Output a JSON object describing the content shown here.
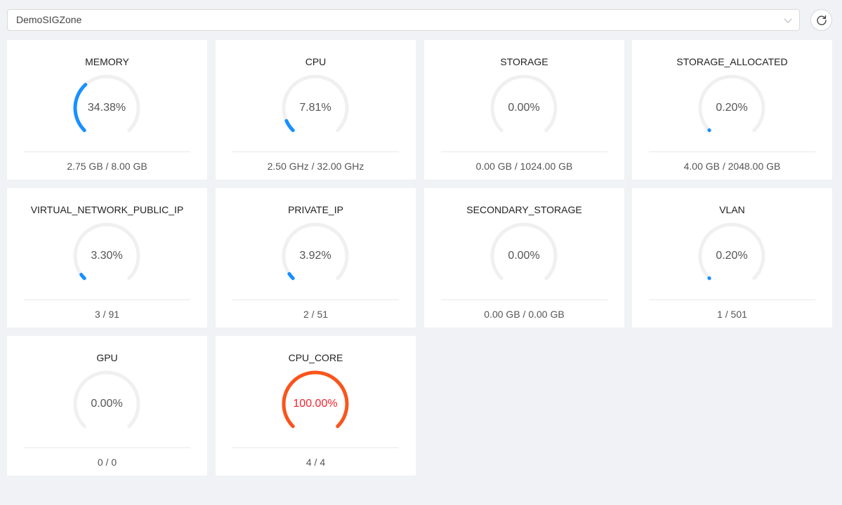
{
  "zone_selector": {
    "value": "DemoSIGZone"
  },
  "colors": {
    "normal": "#1890ff",
    "full": "#fa541c",
    "track": "#f0f0f0"
  },
  "cards": [
    {
      "title": "MEMORY",
      "percent_label": "34.38%",
      "percent": 34.38,
      "usage": "2.75 GB / 8.00 GB"
    },
    {
      "title": "CPU",
      "percent_label": "7.81%",
      "percent": 7.81,
      "usage": "2.50 GHz / 32.00 GHz"
    },
    {
      "title": "STORAGE",
      "percent_label": "0.00%",
      "percent": 0,
      "usage": "0.00 GB / 1024.00 GB"
    },
    {
      "title": "STORAGE_ALLOCATED",
      "percent_label": "0.20%",
      "percent": 0.2,
      "usage": "4.00 GB / 2048.00 GB"
    },
    {
      "title": "VIRTUAL_NETWORK_PUBLIC_IP",
      "percent_label": "3.30%",
      "percent": 3.3,
      "usage": "3 / 91"
    },
    {
      "title": "PRIVATE_IP",
      "percent_label": "3.92%",
      "percent": 3.92,
      "usage": "2 / 51"
    },
    {
      "title": "SECONDARY_STORAGE",
      "percent_label": "0.00%",
      "percent": 0,
      "usage": "0.00 GB / 0.00 GB"
    },
    {
      "title": "VLAN",
      "percent_label": "0.20%",
      "percent": 0.2,
      "usage": "1 / 501"
    },
    {
      "title": "GPU",
      "percent_label": "0.00%",
      "percent": 0,
      "usage": "0 / 0"
    },
    {
      "title": "CPU_CORE",
      "percent_label": "100.00%",
      "percent": 100,
      "usage": "4 / 4"
    }
  ]
}
